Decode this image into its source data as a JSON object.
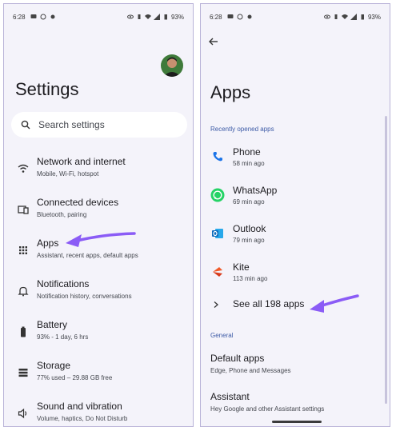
{
  "status_bar": {
    "time": "6:28",
    "battery": "93%"
  },
  "left": {
    "title": "Settings",
    "search_placeholder": "Search settings",
    "items": [
      {
        "title": "Network and internet",
        "subtitle": "Mobile, Wi-Fi, hotspot",
        "icon": "wifi-icon"
      },
      {
        "title": "Connected devices",
        "subtitle": "Bluetooth, pairing",
        "icon": "devices-icon"
      },
      {
        "title": "Apps",
        "subtitle": "Assistant, recent apps, default apps",
        "icon": "apps-grid-icon"
      },
      {
        "title": "Notifications",
        "subtitle": "Notification history, conversations",
        "icon": "bell-icon"
      },
      {
        "title": "Battery",
        "subtitle": "93% - 1 day, 6 hrs",
        "icon": "battery-icon"
      },
      {
        "title": "Storage",
        "subtitle": "77% used – 29.88 GB free",
        "icon": "storage-icon"
      },
      {
        "title": "Sound and vibration",
        "subtitle": "Volume, haptics, Do Not Disturb",
        "icon": "sound-icon"
      }
    ]
  },
  "right": {
    "title": "Apps",
    "recent_section": "Recently opened apps",
    "recent_apps": [
      {
        "name": "Phone",
        "time": "58 min ago",
        "icon": "phone-icon",
        "color": "#1a73e8"
      },
      {
        "name": "WhatsApp",
        "time": "69 min ago",
        "icon": "whatsapp-icon",
        "color": "#25d366"
      },
      {
        "name": "Outlook",
        "time": "79 min ago",
        "icon": "outlook-icon",
        "color": "#0f6cbd"
      },
      {
        "name": "Kite",
        "time": "113 min ago",
        "icon": "kite-icon",
        "color": "#f15a29"
      }
    ],
    "see_all": "See all 198 apps",
    "general_section": "General",
    "general_items": [
      {
        "title": "Default apps",
        "subtitle": "Edge, Phone and Messages"
      },
      {
        "title": "Assistant",
        "subtitle": "Hey Google and other Assistant settings"
      }
    ]
  },
  "colors": {
    "accent": "#8b5cf6",
    "background": "#f4f3fa",
    "section_label": "#3c5aa6"
  }
}
